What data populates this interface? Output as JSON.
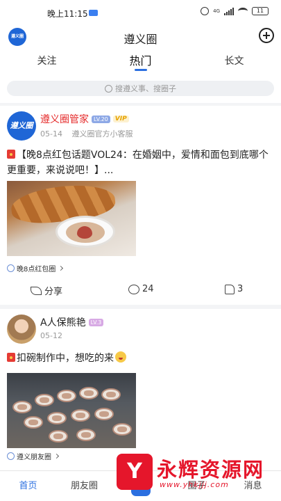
{
  "status_bar": {
    "time": "晚上11:15",
    "network": "4G",
    "battery": "11"
  },
  "header": {
    "title": "遵义圈",
    "logo_text": "遵义圈"
  },
  "tabs": [
    {
      "label": "关注"
    },
    {
      "label": "热门"
    },
    {
      "label": "长文"
    }
  ],
  "search": {
    "placeholder": "搜遵义事、搜圈子"
  },
  "posts": [
    {
      "author": "遵义圈管家",
      "level": "LV.20",
      "vip": "VIP",
      "date": "05-14",
      "source": "遵义圈官方小客服",
      "avatar_text": "遵义圈",
      "title": "【晚8点红包话题VOL24：在婚姻中，爱情和面包到底哪个更重要，来说说吧！】...",
      "topic": "晚8点红包圈",
      "share_label": "分享",
      "comments": "24",
      "likes": "3"
    },
    {
      "author": "A人保熊艳",
      "level": "LV.3",
      "date": "05-12",
      "title": "扣碗制作中，想吃的来",
      "topic": "遵义朋友圈"
    }
  ],
  "bottom_nav": [
    {
      "label": "首页"
    },
    {
      "label": "朋友圈"
    },
    {
      "label": ""
    },
    {
      "label": "圈子"
    },
    {
      "label": "消息"
    }
  ],
  "watermark": {
    "logo": "Y",
    "name": "永辉资源网",
    "url": "www.yhkjjj.com"
  },
  "colors": {
    "accent": "#2b6fe0",
    "author_red": "#e52b2b",
    "vip_gold": "#e6a300",
    "watermark_red": "#e5162b"
  },
  "icons": [
    "add-circle-icon",
    "search-icon",
    "red-packet-icon",
    "topic-icon",
    "chevron-right-icon",
    "share-icon",
    "comment-icon",
    "like-icon",
    "emoji-icon",
    "pen-icon"
  ]
}
